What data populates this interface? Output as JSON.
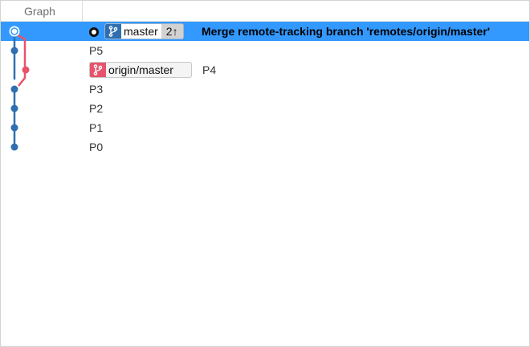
{
  "header": {
    "graph_label": "Graph"
  },
  "head_row": {
    "branch_name": "master",
    "ahead": "2↑",
    "message": "Merge remote-tracking branch 'remotes/origin/master'"
  },
  "remote_row": {
    "branch_name": "origin/master",
    "message": "P4"
  },
  "commits": [
    {
      "message": "P5"
    },
    {
      "message": "P3"
    },
    {
      "message": "P2"
    },
    {
      "message": "P1"
    },
    {
      "message": "P0"
    }
  ],
  "colors": {
    "selection": "#3399ff",
    "main_lane": "#2f6fb0",
    "remote_lane": "#e8536b"
  },
  "icons": {
    "branch": "git-branch-icon",
    "head": "head-marker-icon"
  }
}
